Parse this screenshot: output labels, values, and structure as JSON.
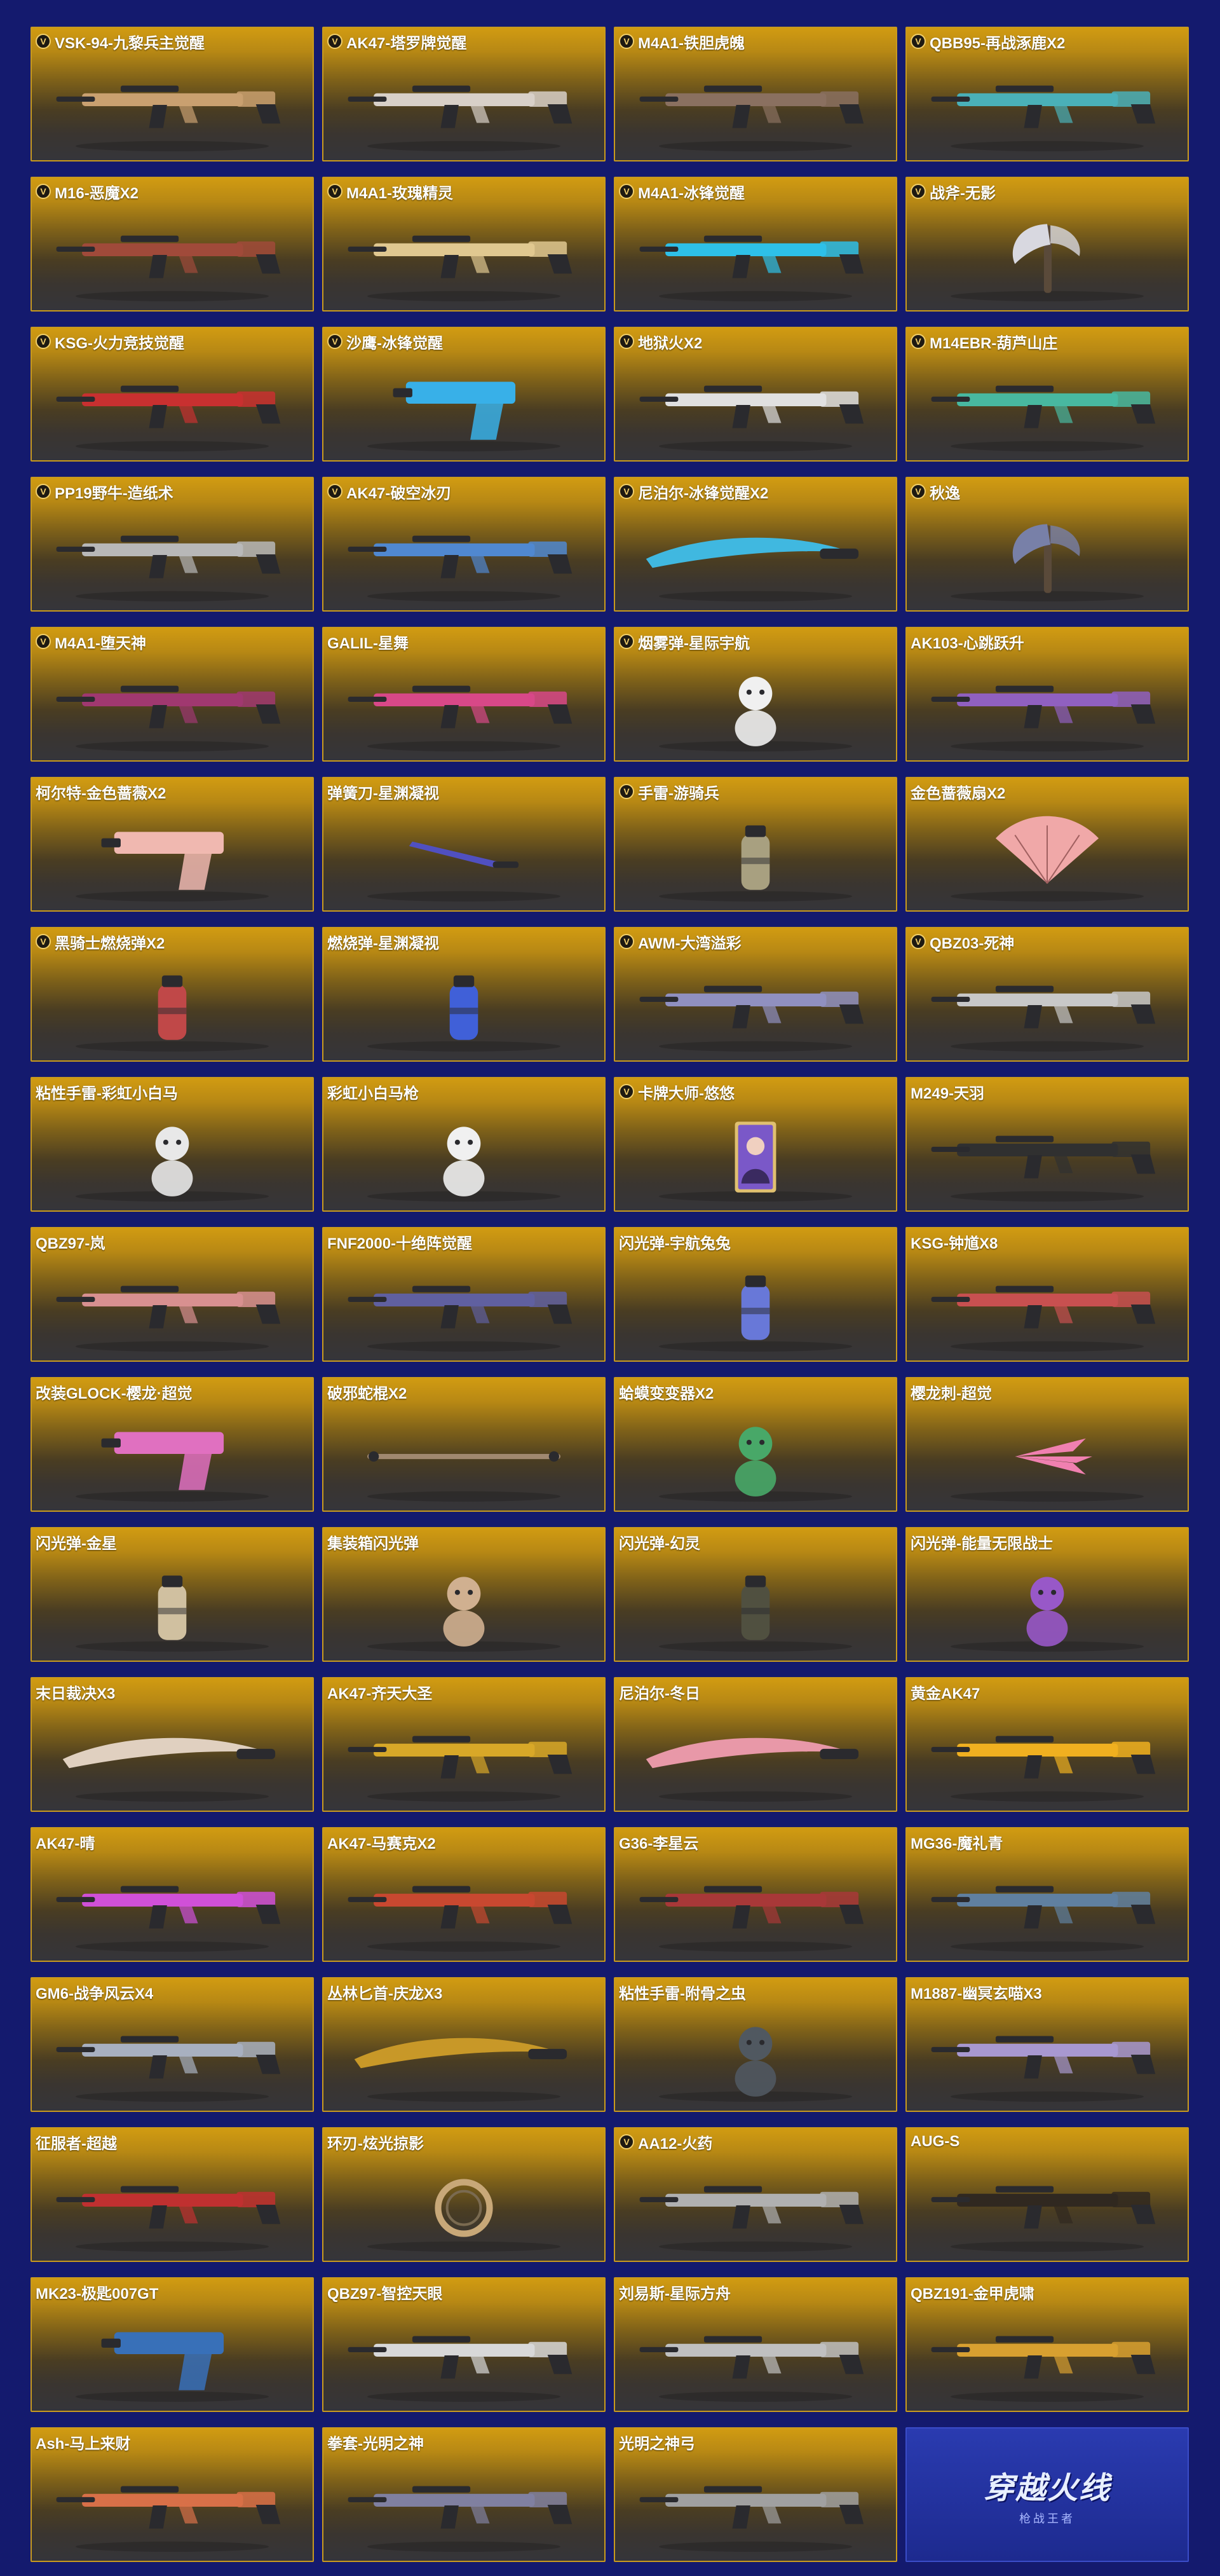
{
  "items": [
    {
      "title": "VSK-94-九黎兵主觉醒",
      "v": true,
      "kind": "gun",
      "color": "#c9a070"
    },
    {
      "title": "AK47-塔罗牌觉醒",
      "v": true,
      "kind": "gun",
      "color": "#d8d0c8"
    },
    {
      "title": "M4A1-铁胆虎魄",
      "v": true,
      "kind": "gun",
      "color": "#8a7060"
    },
    {
      "title": "QBB95-再战涿鹿X2",
      "v": true,
      "kind": "gun",
      "color": "#4ab0b8"
    },
    {
      "title": "M16-恶魔X2",
      "v": true,
      "kind": "gun",
      "color": "#a04a3a"
    },
    {
      "title": "M4A1-玫瑰精灵",
      "v": true,
      "kind": "gun",
      "color": "#e0c890"
    },
    {
      "title": "M4A1-冰锋觉醒",
      "v": true,
      "kind": "gun",
      "color": "#2ec0e8"
    },
    {
      "title": "战斧-无影",
      "v": true,
      "kind": "axe",
      "color": "#d8d8e0"
    },
    {
      "title": "KSG-火力竞技觉醒",
      "v": true,
      "kind": "gun",
      "color": "#c83030"
    },
    {
      "title": "沙鹰-冰锋觉醒",
      "v": true,
      "kind": "pistol",
      "color": "#38b0e8"
    },
    {
      "title": "地狱火X2",
      "v": true,
      "kind": "gun",
      "color": "#e0e0e0"
    },
    {
      "title": "M14EBR-葫芦山庄",
      "v": true,
      "kind": "gun",
      "color": "#48b8a0"
    },
    {
      "title": "PP19野牛-造纸术",
      "v": true,
      "kind": "gun",
      "color": "#b8b8b8"
    },
    {
      "title": "AK47-破空冰刃",
      "v": true,
      "kind": "gun",
      "color": "#5088d0"
    },
    {
      "title": "尼泊尔-冰锋觉醒X2",
      "v": true,
      "kind": "blade",
      "color": "#40b8e0"
    },
    {
      "title": "秋逸",
      "v": true,
      "kind": "axe",
      "color": "#7880a8"
    },
    {
      "title": "M4A1-堕天神",
      "v": true,
      "kind": "gun",
      "color": "#a03870"
    },
    {
      "title": "GALIL-星舞",
      "v": false,
      "kind": "gun",
      "color": "#d84888"
    },
    {
      "title": "烟雾弹-星际宇航",
      "v": true,
      "kind": "figure",
      "color": "#f0f0f0"
    },
    {
      "title": "AK103-心跳跃升",
      "v": false,
      "kind": "gun",
      "color": "#9060c0"
    },
    {
      "title": "柯尔特-金色蔷薇X2",
      "v": false,
      "kind": "pistol",
      "color": "#f0b8b0"
    },
    {
      "title": "弹簧刀-星渊凝视",
      "v": false,
      "kind": "knife",
      "color": "#5050c0"
    },
    {
      "title": "手雷-游骑兵",
      "v": true,
      "kind": "grenade",
      "color": "#a8a080"
    },
    {
      "title": "金色蔷薇扇X2",
      "v": false,
      "kind": "fan",
      "color": "#f0a8a8"
    },
    {
      "title": "黑骑士燃烧弹X2",
      "v": true,
      "kind": "grenade",
      "color": "#c04848"
    },
    {
      "title": "燃烧弹-星渊凝视",
      "v": false,
      "kind": "grenade",
      "color": "#4060d8"
    },
    {
      "title": "AWM-大湾溢彩",
      "v": true,
      "kind": "gun",
      "color": "#9090c0"
    },
    {
      "title": "QBZ03-死神",
      "v": true,
      "kind": "gun",
      "color": "#c8c8c8"
    },
    {
      "title": "粘性手雷-彩虹小白马",
      "v": false,
      "kind": "figure",
      "color": "#e8e8e8"
    },
    {
      "title": "彩虹小白马枪",
      "v": false,
      "kind": "figure",
      "color": "#f0f0f0"
    },
    {
      "title": "卡牌大师-悠悠",
      "v": true,
      "kind": "card",
      "color": "#7a58c8"
    },
    {
      "title": "M249-天羽",
      "v": false,
      "kind": "gun",
      "color": "#303030"
    },
    {
      "title": "QBZ97-岚",
      "v": false,
      "kind": "gun",
      "color": "#d89090"
    },
    {
      "title": "FNF2000-十绝阵觉醒",
      "v": false,
      "kind": "gun",
      "color": "#6060a0"
    },
    {
      "title": "闪光弹-宇航兔兔",
      "v": false,
      "kind": "grenade",
      "color": "#6878d8"
    },
    {
      "title": "KSG-钟馗X8",
      "v": false,
      "kind": "gun",
      "color": "#c85050"
    },
    {
      "title": "改装GLOCK-樱龙·超觉",
      "v": false,
      "kind": "pistol",
      "color": "#e070c0"
    },
    {
      "title": "破邪蛇棍X2",
      "v": false,
      "kind": "staff",
      "color": "#a08870"
    },
    {
      "title": "蛤蟆变变器X2",
      "v": false,
      "kind": "figure",
      "color": "#48a868"
    },
    {
      "title": "樱龙刺-超觉",
      "v": false,
      "kind": "claw",
      "color": "#f080b0"
    },
    {
      "title": "闪光弹-金星",
      "v": false,
      "kind": "grenade",
      "color": "#d0c0a0"
    },
    {
      "title": "集装箱闪光弹",
      "v": false,
      "kind": "figure",
      "color": "#d0b090"
    },
    {
      "title": "闪光弹-幻灵",
      "v": false,
      "kind": "grenade",
      "color": "#505040"
    },
    {
      "title": "闪光弹-能量无限战士",
      "v": false,
      "kind": "figure",
      "color": "#9858c8"
    },
    {
      "title": "末日裁决X3",
      "v": false,
      "kind": "blade",
      "color": "#e0d0c0"
    },
    {
      "title": "AK47-齐天大圣",
      "v": false,
      "kind": "gun",
      "color": "#d8a828"
    },
    {
      "title": "尼泊尔-冬日",
      "v": false,
      "kind": "blade",
      "color": "#e898a8"
    },
    {
      "title": "黄金AK47",
      "v": false,
      "kind": "gun",
      "color": "#f0b020"
    },
    {
      "title": "AK47-晴",
      "v": false,
      "kind": "gun",
      "color": "#d050d8"
    },
    {
      "title": "AK47-马赛克X2",
      "v": false,
      "kind": "gun",
      "color": "#c84830"
    },
    {
      "title": "G36-李星云",
      "v": false,
      "kind": "gun",
      "color": "#a83838"
    },
    {
      "title": "MG36-魔礼青",
      "v": false,
      "kind": "gun",
      "color": "#6080a0"
    },
    {
      "title": "GM6-战争风云X4",
      "v": false,
      "kind": "gun",
      "color": "#a8b0c0"
    },
    {
      "title": "丛林匕首-庆龙X3",
      "v": false,
      "kind": "blade",
      "color": "#c89828"
    },
    {
      "title": "粘性手雷-附骨之虫",
      "v": false,
      "kind": "figure",
      "color": "#505860"
    },
    {
      "title": "M1887-幽冥玄喵X3",
      "v": false,
      "kind": "gun",
      "color": "#a898d0"
    },
    {
      "title": "征服者-超越",
      "v": false,
      "kind": "gun",
      "color": "#c03030"
    },
    {
      "title": "环刃-炫光掠影",
      "v": false,
      "kind": "ring",
      "color": "#c8a878"
    },
    {
      "title": "AA12-火药",
      "v": true,
      "kind": "gun",
      "color": "#b0b0b0"
    },
    {
      "title": "AUG-S",
      "v": false,
      "kind": "gun",
      "color": "#302820"
    },
    {
      "title": "MK23-极匙007GT",
      "v": false,
      "kind": "pistol",
      "color": "#3870b8"
    },
    {
      "title": "QBZ97-智控天眼",
      "v": false,
      "kind": "gun",
      "color": "#d8d8d8"
    },
    {
      "title": "刘易斯-星际方舟",
      "v": false,
      "kind": "gun",
      "color": "#c0c0c0"
    },
    {
      "title": "QBZ191-金甲虎啸",
      "v": false,
      "kind": "gun",
      "color": "#d8a030"
    },
    {
      "title": "Ash-马上来财",
      "v": false,
      "kind": "gun",
      "color": "#d87048"
    },
    {
      "title": "拳套-光明之神",
      "v": false,
      "kind": "gun",
      "color": "#8080a0"
    },
    {
      "title": "光明之神弓",
      "v": false,
      "kind": "gun",
      "color": "#a0a0a0"
    }
  ],
  "logo": {
    "main": "穿越火线",
    "sub": "枪战王者"
  },
  "colors": {
    "page_bg": "#141a6e",
    "card_border": "#c89a1e",
    "title_text": "#ffffff",
    "badge_gold": "#f2cf6a"
  }
}
